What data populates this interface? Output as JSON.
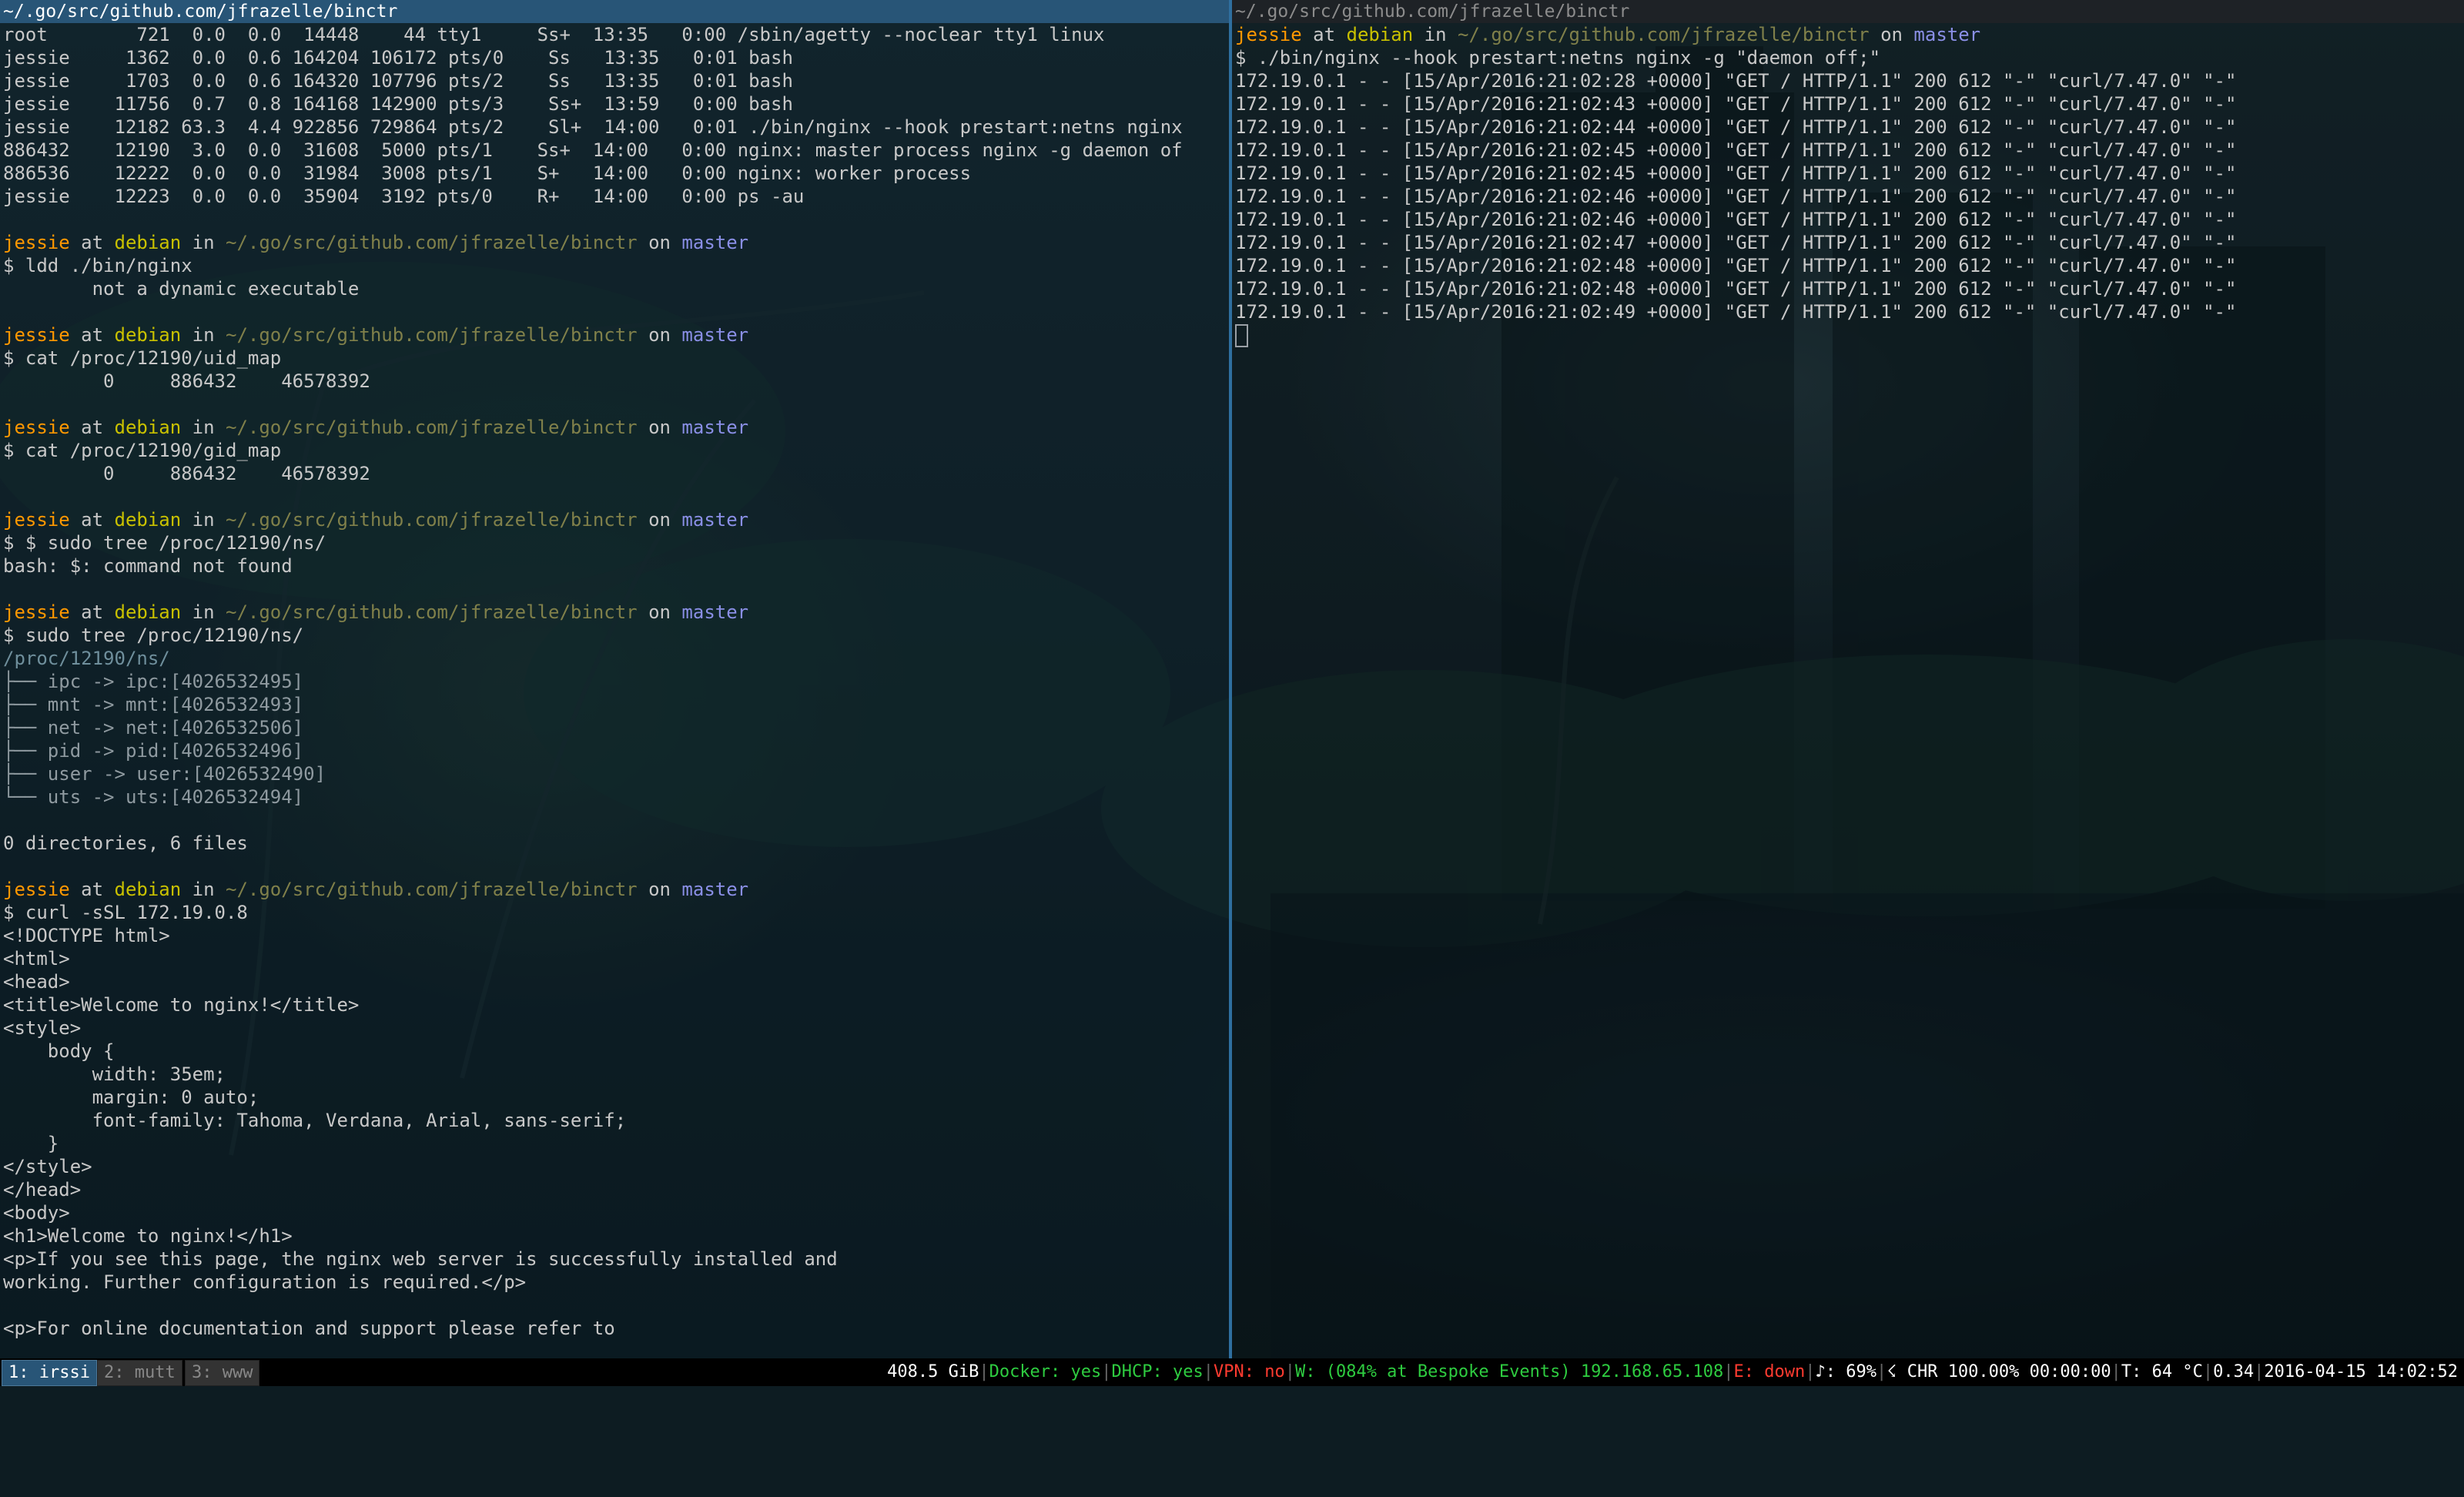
{
  "left_pane": {
    "title": "~/.go/src/github.com/jfrazelle/binctr",
    "ps_rows": [
      "root        721  0.0  0.0  14448    44 tty1     Ss+  13:35   0:00 /sbin/agetty --noclear tty1 linux",
      "jessie     1362  0.0  0.6 164204 106172 pts/0    Ss   13:35   0:01 bash",
      "jessie     1703  0.0  0.6 164320 107796 pts/2    Ss   13:35   0:01 bash",
      "jessie    11756  0.7  0.8 164168 142900 pts/3    Ss+  13:59   0:00 bash",
      "jessie    12182 63.3  4.4 922856 729864 pts/2    Sl+  14:00   0:01 ./bin/nginx --hook prestart:netns nginx",
      "886432    12190  3.0  0.0  31608  5000 pts/1    Ss+  14:00   0:00 nginx: master process nginx -g daemon of",
      "886536    12222  0.0  0.0  31984  3008 pts/1    S+   14:00   0:00 nginx: worker process",
      "jessie    12223  0.0  0.0  35904  3192 pts/0    R+   14:00   0:00 ps -au"
    ],
    "prompt": {
      "user": "jessie",
      "at": " at ",
      "host": "debian",
      "in": " in ",
      "path": "~/.go/src/github.com/jfrazelle/binctr",
      "on": " on ",
      "branch": "master"
    },
    "cmd_ldd": "$ ldd ./bin/nginx",
    "out_ldd": "        not a dynamic executable",
    "cmd_uid": "$ cat /proc/12190/uid_map",
    "out_uid": "         0     886432    46578392",
    "cmd_gid": "$ cat /proc/12190/gid_map",
    "out_gid": "         0     886432    46578392",
    "cmd_tree_bad": "$ $ sudo tree /proc/12190/ns/",
    "out_tree_bad": "bash: $: command not found",
    "cmd_tree": "$ sudo tree /proc/12190/ns/",
    "tree_root": "/proc/12190/ns/",
    "tree_entries": [
      "├── ipc -> ipc:[4026532495]",
      "├── mnt -> mnt:[4026532493]",
      "├── net -> net:[4026532506]",
      "├── pid -> pid:[4026532496]",
      "├── user -> user:[4026532490]",
      "└── uts -> uts:[4026532494]"
    ],
    "tree_summary": "0 directories, 6 files",
    "cmd_curl": "$ curl -sSL 172.19.0.8",
    "curl_output": [
      "<!DOCTYPE html>",
      "<html>",
      "<head>",
      "<title>Welcome to nginx!</title>",
      "<style>",
      "    body {",
      "        width: 35em;",
      "        margin: 0 auto;",
      "        font-family: Tahoma, Verdana, Arial, sans-serif;",
      "    }",
      "</style>",
      "</head>",
      "<body>",
      "<h1>Welcome to nginx!</h1>",
      "<p>If you see this page, the nginx web server is successfully installed and",
      "working. Further configuration is required.</p>",
      "",
      "<p>For online documentation and support please refer to"
    ]
  },
  "right_pane": {
    "title": "~/.go/src/github.com/jfrazelle/binctr",
    "cmd": "$ ./bin/nginx --hook prestart:netns nginx -g \"daemon off;\"",
    "log_lines": [
      "172.19.0.1 - - [15/Apr/2016:21:02:28 +0000] \"GET / HTTP/1.1\" 200 612 \"-\" \"curl/7.47.0\" \"-\"",
      "172.19.0.1 - - [15/Apr/2016:21:02:43 +0000] \"GET / HTTP/1.1\" 200 612 \"-\" \"curl/7.47.0\" \"-\"",
      "172.19.0.1 - - [15/Apr/2016:21:02:44 +0000] \"GET / HTTP/1.1\" 200 612 \"-\" \"curl/7.47.0\" \"-\"",
      "172.19.0.1 - - [15/Apr/2016:21:02:45 +0000] \"GET / HTTP/1.1\" 200 612 \"-\" \"curl/7.47.0\" \"-\"",
      "172.19.0.1 - - [15/Apr/2016:21:02:45 +0000] \"GET / HTTP/1.1\" 200 612 \"-\" \"curl/7.47.0\" \"-\"",
      "172.19.0.1 - - [15/Apr/2016:21:02:46 +0000] \"GET / HTTP/1.1\" 200 612 \"-\" \"curl/7.47.0\" \"-\"",
      "172.19.0.1 - - [15/Apr/2016:21:02:46 +0000] \"GET / HTTP/1.1\" 200 612 \"-\" \"curl/7.47.0\" \"-\"",
      "172.19.0.1 - - [15/Apr/2016:21:02:47 +0000] \"GET / HTTP/1.1\" 200 612 \"-\" \"curl/7.47.0\" \"-\"",
      "172.19.0.1 - - [15/Apr/2016:21:02:48 +0000] \"GET / HTTP/1.1\" 200 612 \"-\" \"curl/7.47.0\" \"-\"",
      "172.19.0.1 - - [15/Apr/2016:21:02:48 +0000] \"GET / HTTP/1.1\" 200 612 \"-\" \"curl/7.47.0\" \"-\"",
      "172.19.0.1 - - [15/Apr/2016:21:02:49 +0000] \"GET / HTTP/1.1\" 200 612 \"-\" \"curl/7.47.0\" \"-\""
    ]
  },
  "statusbar": {
    "workspaces": [
      "1: irssi",
      "2: mutt",
      "3: www"
    ],
    "disk": "408.5 GiB",
    "docker": "Docker: yes",
    "dhcp": "DHCP: yes",
    "vpn": "VPN: no",
    "wifi": "W: (084% at Bespoke Events) 192.168.65.108",
    "ethernet": "E: down",
    "volume": "♪: 69%",
    "battery": "☇ CHR 100.00% 00:00:00",
    "temp": "T: 64 °C",
    "load": "0.34",
    "datetime": "2016-04-15 14:02:52"
  },
  "colors": {
    "active_title_bg": "#285577",
    "username": "#ff9800",
    "hostname": "#c9c100",
    "branch": "#8a8fe6",
    "status_ok": "#2ecc40",
    "status_bad": "#ff3b30"
  }
}
